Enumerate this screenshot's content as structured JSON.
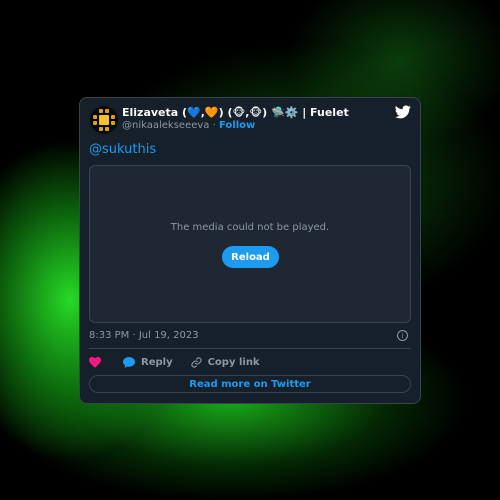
{
  "tweet": {
    "display_name": "Elizaveta (💙,🧡) (🐵,🐵) 🛸⚙️ | Fuelet",
    "handle": "@nikaalekseeeva",
    "separator": "·",
    "follow_label": "Follow",
    "mention": "@sukuthis",
    "media_message": "The media could not be played.",
    "reload_label": "Reload",
    "timestamp": "8:33 PM · Jul 19, 2023",
    "info_glyph": "i",
    "reply_label": "Reply",
    "copy_link_label": "Copy link",
    "read_more_label": "Read more on Twitter"
  },
  "icons": {
    "brand": "twitter-bird",
    "like": "heart",
    "reply": "speech-bubble",
    "copy": "link",
    "info": "info-circle"
  },
  "colors": {
    "card_bg": "#15202b",
    "border": "#38444d",
    "accent": "#1d9bf0",
    "heart": "#f91880",
    "muted": "#8b98a5",
    "text": "#f7f9f9"
  }
}
